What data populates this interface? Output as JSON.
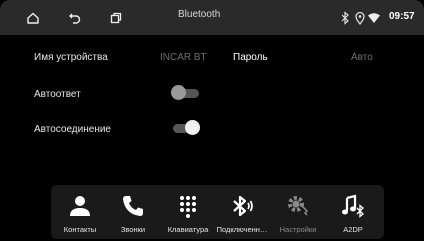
{
  "statusbar": {
    "title": "Bluetooth",
    "time": "09:57",
    "icons": [
      "home-icon",
      "back-icon",
      "recent-apps-icon",
      "bluetooth-status-icon",
      "location-icon",
      "wifi-icon"
    ]
  },
  "settings": {
    "device_name_label": "Имя устройства",
    "device_name_value": "INCAR BT",
    "password_label": "Пароль",
    "password_value": "Авто",
    "auto_answer_label": "Автоответ",
    "auto_answer_on": false,
    "auto_connect_label": "Автосоединение",
    "auto_connect_on": true
  },
  "dock": {
    "items": [
      {
        "label": "Контакты",
        "icon": "contacts-icon",
        "active": true
      },
      {
        "label": "Звонки",
        "icon": "phone-icon",
        "active": true
      },
      {
        "label": "Клавиатура",
        "icon": "dialpad-icon",
        "active": true
      },
      {
        "label": "Подключенн…",
        "icon": "bluetooth-connected-icon",
        "active": true
      },
      {
        "label": "Настройки",
        "icon": "settings-icon",
        "active": false
      },
      {
        "label": "A2DP",
        "icon": "bluetooth-music-icon",
        "active": true
      }
    ]
  }
}
